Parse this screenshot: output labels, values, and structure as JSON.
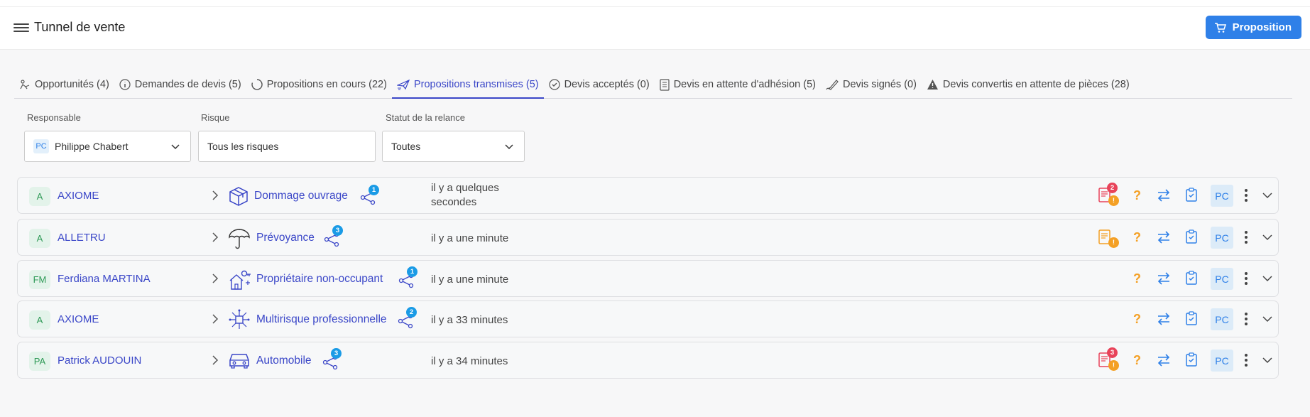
{
  "header": {
    "title": "Tunnel de vente",
    "proposition_label": "Proposition"
  },
  "tabs": [
    {
      "label": "Opportunités (4)",
      "icon": "person-bed-icon"
    },
    {
      "label": "Demandes de devis (5)",
      "icon": "info-icon"
    },
    {
      "label": "Propositions en cours (22)",
      "icon": "spinner-icon"
    },
    {
      "label": "Propositions transmises (5)",
      "icon": "paper-plane-icon"
    },
    {
      "label": "Devis acceptés (0)",
      "icon": "check-circle-icon"
    },
    {
      "label": "Devis en attente d'adhésion (5)",
      "icon": "document-icon"
    },
    {
      "label": "Devis signés (0)",
      "icon": "pen-icon"
    },
    {
      "label": "Devis convertis en attente de pièces (28)",
      "icon": "warning-icon"
    }
  ],
  "filters": {
    "responsable": {
      "label": "Responsable",
      "value": "Philippe Chabert",
      "initials": "PC"
    },
    "risque": {
      "label": "Risque",
      "value": "Tous les risques"
    },
    "statut": {
      "label": "Statut de la relance",
      "value": "Toutes"
    }
  },
  "rows": [
    {
      "initials": "A",
      "client": "AXIOME",
      "risk": "Dommage ouvrage",
      "risk_icon": "box-icon",
      "count": "1",
      "time": "il y a quelques secondes",
      "doc_count": "2",
      "doc_color": "#e8435a",
      "owner": "PC"
    },
    {
      "initials": "A",
      "client": "ALLETRU",
      "risk": "Prévoyance",
      "risk_icon": "umbrella-icon",
      "count": "3",
      "time": "il y a une minute",
      "doc_count": "",
      "doc_color": "#f4a025",
      "owner": "PC"
    },
    {
      "initials": "FM",
      "client": "Ferdiana MARTINA",
      "risk": "Propriétaire non-occupant",
      "risk_icon": "house-key-icon",
      "count": "1",
      "time": "il y a une minute",
      "doc_count": null,
      "doc_color": null,
      "owner": "PC"
    },
    {
      "initials": "A",
      "client": "AXIOME",
      "risk": "Multirisque professionnelle",
      "risk_icon": "network-icon",
      "count": "2",
      "time": "il y a 33 minutes",
      "doc_count": null,
      "doc_color": null,
      "owner": "PC"
    },
    {
      "initials": "PA",
      "client": "Patrick AUDOUIN",
      "risk": "Automobile",
      "risk_icon": "car-icon",
      "count": "3",
      "time": "il y a 34 minutes",
      "doc_count": "3",
      "doc_color": "#e8435a",
      "owner": "PC"
    }
  ],
  "actions": {
    "question": "?",
    "alert": "!"
  },
  "colors": {
    "primary": "#2f80e8",
    "link": "#3b47c8",
    "warning": "#f4a025",
    "danger": "#e8435a",
    "badge": "#1a9be6"
  }
}
